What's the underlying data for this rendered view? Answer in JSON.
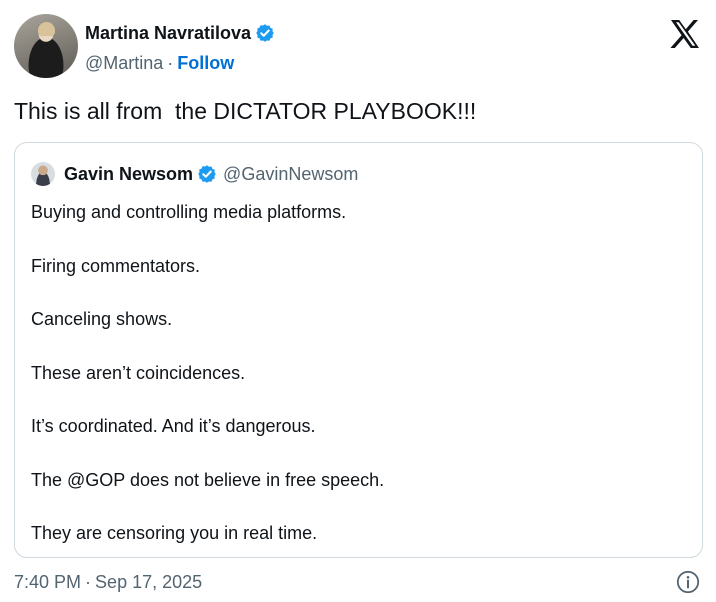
{
  "author": {
    "display_name": "Martina Navratilova",
    "handle": "@Martina",
    "separator": "·",
    "follow_label": "Follow"
  },
  "tweet": {
    "text": "This is all from  the DICTATOR PLAYBOOK!!!"
  },
  "quoted": {
    "display_name": "Gavin Newsom",
    "handle": "@GavinNewsom",
    "lines": [
      "Buying and controlling media platforms.",
      "Firing commentators.",
      "Canceling shows.",
      "These aren’t coincidences.",
      "It’s coordinated. And it’s dangerous.",
      "The @GOP does not believe in free speech.",
      "They are censoring you in real time."
    ]
  },
  "footer": {
    "time": "7:40 PM",
    "separator": "·",
    "date": "Sep 17, 2025"
  },
  "colors": {
    "link_blue": "#006fd6",
    "verified_blue": "#1d9bf0",
    "secondary_text": "#536471",
    "border": "#cfd9de"
  },
  "icons": {
    "verified": "verified-badge-icon",
    "logo": "x-logo-icon",
    "info": "info-icon"
  }
}
